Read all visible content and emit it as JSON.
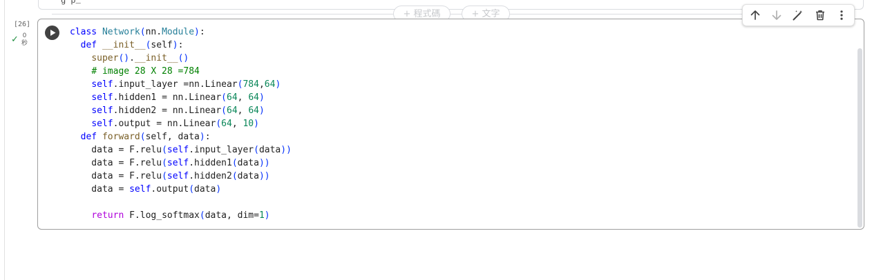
{
  "previous_cell": {
    "visible_text": "g            p_"
  },
  "insert_bar": {
    "add_code_label": "+ 程式碼",
    "add_text_label": "+ 文字"
  },
  "cell": {
    "execution_count": "[26]",
    "status": "✓",
    "duration_value": "0",
    "duration_unit": "秒"
  },
  "toolbar": {
    "items": [
      {
        "name": "move-up",
        "icon": "arrow-up-icon"
      },
      {
        "name": "move-down",
        "icon": "arrow-down-icon"
      },
      {
        "name": "edit",
        "icon": "magic-wand-icon"
      },
      {
        "name": "delete",
        "icon": "trash-icon"
      },
      {
        "name": "more",
        "icon": "more-vert-icon"
      }
    ]
  },
  "code_lines": [
    "class Network(nn.Module):",
    "  def __init__(self):",
    "    super().__init__()",
    "    # image 28 X 28 =784",
    "    self.input_layer =nn.Linear(784,64)",
    "    self.hidden1 = nn.Linear(64, 64)",
    "    self.hidden2 = nn.Linear(64, 64)",
    "    self.output = nn.Linear(64, 10)",
    "  def forward(self, data):",
    "    data = F.relu(self.input_layer(data))",
    "    data = F.relu(self.hidden1(data))",
    "    data = F.relu(self.hidden2(data))",
    "    data = self.output(data)",
    "",
    "    return F.log_softmax(data, dim=1)"
  ],
  "colors": {
    "keyword": "#0000ff",
    "return_keyword": "#af00db",
    "class_name": "#267f99",
    "function_name": "#795e26",
    "number": "#098658",
    "comment": "#008000",
    "bracket": "#0431fa",
    "success": "#1e8e3e"
  }
}
